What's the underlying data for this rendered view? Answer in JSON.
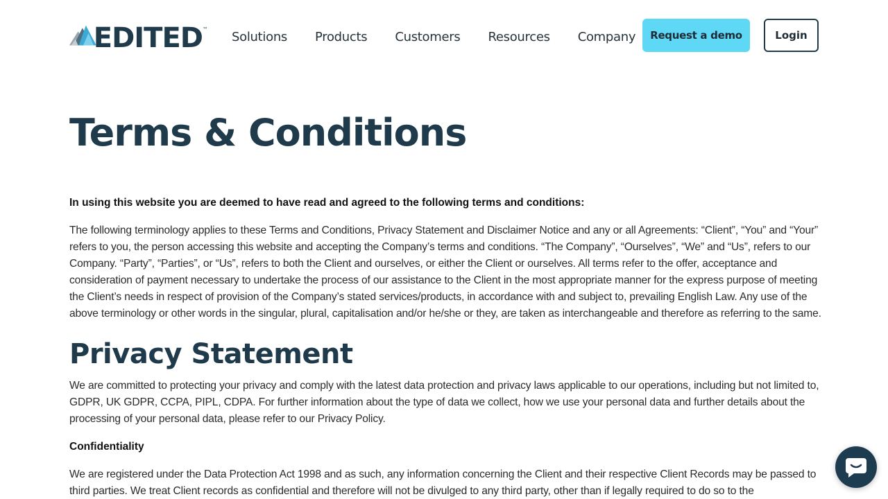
{
  "brand": {
    "logo_text": "EDITED",
    "trademark": "™"
  },
  "nav": {
    "items": [
      {
        "label": "Solutions"
      },
      {
        "label": "Products"
      },
      {
        "label": "Customers"
      },
      {
        "label": "Resources"
      },
      {
        "label": "Company"
      }
    ],
    "demo_button": "Request a demo",
    "login_button": "Login"
  },
  "main": {
    "title": "Terms & Conditions",
    "lead": "In using this website you are deemed to have read and agreed to the following terms and conditions:",
    "terminology": "The following terminology applies to these Terms and Conditions, Privacy Statement and Disclaimer Notice and any or all Agreements: “Client”, “You” and “Your” refers to you, the person accessing this website and accepting the Company’s terms and conditions. “The Company”, “Ourselves”, “We” and “Us”, refers to our Company. “Party”, “Parties”, or “Us”, refers to both the Client and ourselves, or either the Client or ourselves. All terms refer to the offer, acceptance and consideration of payment necessary to undertake the process of our assistance to the Client in the most appropriate manner for the express purpose of meeting the Client’s needs in respect of provision of the Company’s stated services/products, in accordance with and subject to, prevailing English Law. Any use of the above terminology or other words in the singular, plural, capitalisation and/or he/she or they, are taken as interchangeable and therefore as referring to the same.",
    "privacy_title": "Privacy Statement",
    "privacy_text": "We are committed to protecting your privacy and comply with the latest data protection and privacy laws applicable to our operations, including but not limited to, GDPR, UK GDPR, CCPA, PIPL, CDPA.   For further information about the type of data we collect, how we use your personal data and further details about the processing of your personal data, please refer to our Privacy Policy.",
    "confidentiality_title": "Confidentiality",
    "confidentiality_text": "We are registered under the Data Protection Act 1998 and as such, any information concerning the Client and their respective Client Records may be passed to third parties. We treat Client records as confidential and therefore will not be divulged to any third party, other than if legally required to do so to the"
  },
  "colors": {
    "brand_dark": "#1f3a4a",
    "accent_cyan": "#5fd8f5",
    "chat_bg": "#1e3c50"
  },
  "icons": {
    "logo": "mountain-logo-icon",
    "chat": "chat-bubble-icon"
  }
}
